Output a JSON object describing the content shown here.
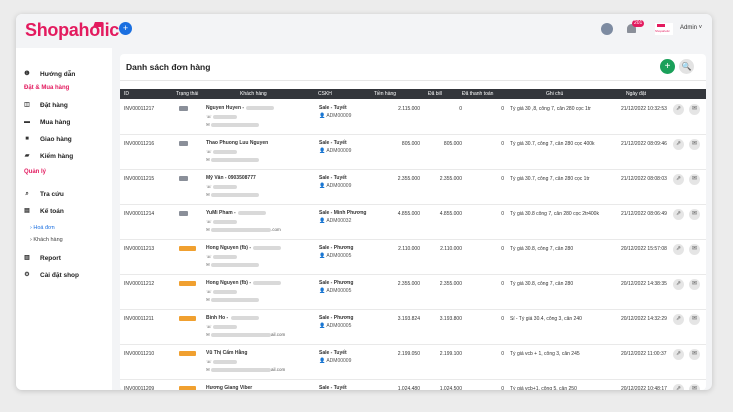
{
  "header": {
    "logo": "Shopaholic",
    "menu_icon": "plus-icon",
    "notification_count": "201",
    "avatar_text": "Shopaholic",
    "user": "Admin ˅"
  },
  "sidebar": {
    "items": [
      {
        "icon": "info-icon",
        "label": "Hướng dẫn"
      },
      {
        "icon": "order-icon",
        "label": "Đặt hàng"
      },
      {
        "icon": "cart-icon",
        "label": "Mua hàng"
      },
      {
        "icon": "truck-icon",
        "label": "Giao hàng"
      },
      {
        "icon": "box-icon",
        "label": "Kiểm hàng"
      },
      {
        "icon": "search-icon",
        "label": "Tra cứu"
      },
      {
        "icon": "accounting-icon",
        "label": "Kế toán"
      },
      {
        "icon": "chart-icon",
        "label": "Report"
      },
      {
        "icon": "settings-icon",
        "label": "Cài đặt shop"
      }
    ],
    "sections": [
      "Đặt & Mua hàng",
      "Quản lý"
    ],
    "sub_items": [
      "Hoá đơn",
      "Khách hàng"
    ]
  },
  "main": {
    "title": "Danh sách đơn hàng",
    "add_label": "+",
    "search_label": "🔍",
    "columns": [
      "ID",
      "Trạng thái",
      "Khách hàng",
      "CSKH",
      "Tiền hàng",
      "Đã bill",
      "Đã thanh toán",
      "Ghi chú",
      "Ngày đặt"
    ],
    "rows": [
      {
        "id": "INV00011217",
        "status": "",
        "customer": "Nguyen Huyen - ",
        "email_suffix": "",
        "staff": "Sale - Tuyết",
        "staff_id": "ADM00009",
        "amount": "2.115.000",
        "billed": "0",
        "paid": "0",
        "note": "Tỷ giá 30 ,8, công 7, cân 280 cọc 1tr",
        "date": "21/12/2022 10:32:53"
      },
      {
        "id": "INV00011216",
        "status": "",
        "customer": "Thao Phuong Luu Nguyen",
        "email_suffix": "",
        "staff": "Sale - Tuyết",
        "staff_id": "ADM00009",
        "amount": "805.000",
        "billed": "805.000",
        "paid": "0",
        "note": "Tỷ giá 30.7, công 7, cân 280 cọc 400k",
        "date": "21/12/2022 08:09:46"
      },
      {
        "id": "INV00011215",
        "status": "",
        "customer": "Mỹ Vân - 0903508777",
        "email_suffix": "",
        "staff": "Sale - Tuyết",
        "staff_id": "ADM00009",
        "amount": "2.355.000",
        "billed": "2.355.000",
        "paid": "0",
        "note": "Tỷ giá 30.7, công 7, cân 280 cọc 1tr",
        "date": "21/12/2022 08:08:03"
      },
      {
        "id": "INV00011214",
        "status": "",
        "customer": "YuMi Pham - ",
        "email_suffix": ".com",
        "staff": "Sale - Minh Phương",
        "staff_id": "ADM00032",
        "amount": "4.855.000",
        "billed": "4.855.000",
        "paid": "0",
        "note": "Tỷ giá 30.8 công 7, cân 280 cọc 2tr400k",
        "date": "21/12/2022 08:06:49"
      },
      {
        "id": "INV00011213",
        "status": "",
        "customer": "Hong Nguyen (fb) - ",
        "email_suffix": "",
        "staff": "Sale - Phương",
        "staff_id": "ADM00005",
        "amount": "2.110.000",
        "billed": "2.110.000",
        "paid": "0",
        "note": "Tỷ giá 30.8, công 7, cân 280",
        "date": "20/12/2022 15:57:08"
      },
      {
        "id": "INV00011212",
        "status": "",
        "customer": "Hong Nguyen (fb) - ",
        "email_suffix": "",
        "staff": "Sale - Phương",
        "staff_id": "ADM00005",
        "amount": "2.355.000",
        "billed": "2.355.000",
        "paid": "0",
        "note": "Tỷ giá 30.8, công 7, cân 280",
        "date": "20/12/2022 14:38:35"
      },
      {
        "id": "INV00011211",
        "status": "",
        "customer": "Binh Ho - ",
        "email_suffix": "ail.com",
        "staff": "Sale - Phương",
        "staff_id": "ADM00005",
        "amount": "3.193.824",
        "billed": "3.193.800",
        "paid": "0",
        "note": "Sỉ - Tỷ giá 30.4, công 3, cân 240",
        "date": "20/12/2022 14:32:29"
      },
      {
        "id": "INV00011210",
        "status": "",
        "customer": "Vũ Thị Cẩm Hằng",
        "email_suffix": "ail.com",
        "staff": "Sale - Tuyết",
        "staff_id": "ADM00009",
        "amount": "2.199.050",
        "billed": "2.199.100",
        "paid": "0",
        "note": "Tỷ giá vcb + 1, công 3, cân 245",
        "date": "20/12/2022 11:00:37"
      },
      {
        "id": "INV00011209",
        "status": "",
        "customer": "Hương Giang Viber",
        "email_suffix": "",
        "staff": "Sale - Tuyết",
        "staff_id": "",
        "amount": "1.024.480",
        "billed": "1.024.500",
        "paid": "0",
        "note": "Tỷ giá vcb+1, công 5, cân 250",
        "date": "20/12/2022 10:48:17"
      }
    ]
  },
  "colors": {
    "brand": "#e31b5f",
    "primary": "#1a6fe0",
    "success": "#1aa05a",
    "status_gray": "#8a8f99",
    "status_orange": "#f0a030"
  }
}
